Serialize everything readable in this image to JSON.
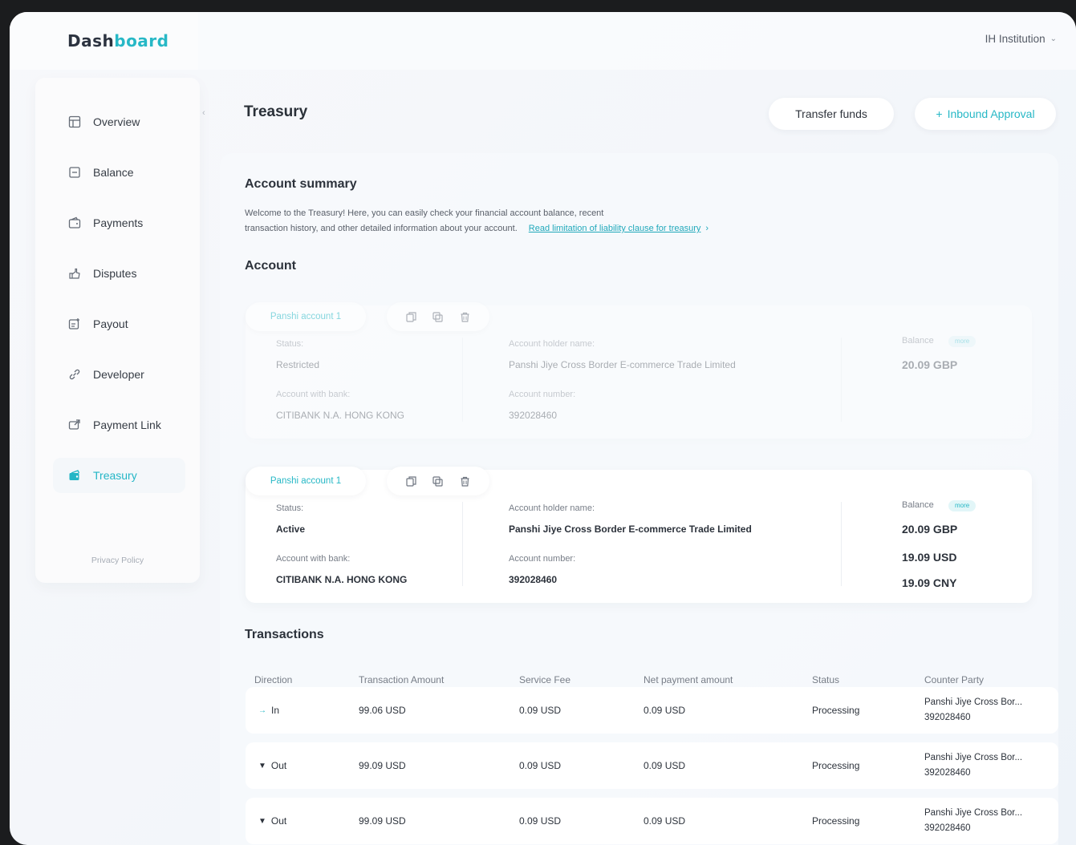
{
  "app": {
    "logo_part1": "Dash",
    "logo_part2": "board",
    "institution": "IH Institution"
  },
  "sidebar": {
    "items": [
      {
        "label": "Overview",
        "icon": "grid-icon"
      },
      {
        "label": "Balance",
        "icon": "balance-icon"
      },
      {
        "label": "Payments",
        "icon": "wallet-icon"
      },
      {
        "label": "Disputes",
        "icon": "hand-icon"
      },
      {
        "label": "Payout",
        "icon": "payout-icon"
      },
      {
        "label": "Developer",
        "icon": "link-icon"
      },
      {
        "label": "Payment Link",
        "icon": "payment-link-icon"
      },
      {
        "label": "Treasury",
        "icon": "treasury-icon",
        "active": true
      }
    ],
    "privacy": "Privacy Policy"
  },
  "header": {
    "title": "Treasury",
    "transfer_label": "Transfer funds",
    "inbound_label": "Inbound Approval",
    "inbound_prefix": "+"
  },
  "summary": {
    "title": "Account summary",
    "text_line1": "Welcome to the Treasury! Here, you can easily check your financial account balance, recent",
    "text_line2": "transaction history, and other detailed information about your account.",
    "link": "Read limitation of liability clause for treasury",
    "link_arrow": "›"
  },
  "account_section": {
    "title": "Account"
  },
  "accounts": [
    {
      "tab": "Panshi account 1",
      "status_label": "Status:",
      "status": "Restricted",
      "bank_label": "Account with bank:",
      "bank": "CITIBANK N.A. HONG KONG",
      "holder_label": "Account holder name:",
      "holder": "Panshi Jiye Cross Border E-commerce Trade Limited",
      "number_label": "Account number:",
      "number": "392028460",
      "balance_label": "Balance",
      "badge": "more",
      "balances": [
        "20.09 GBP"
      ]
    },
    {
      "tab": "Panshi account 1",
      "status_label": "Status:",
      "status": "Active",
      "bank_label": "Account with bank:",
      "bank": "CITIBANK N.A. HONG KONG",
      "holder_label": "Account holder name:",
      "holder": "Panshi Jiye Cross Border E-commerce Trade Limited",
      "number_label": "Account number:",
      "number": "392028460",
      "balance_label": "Balance",
      "badge": "more",
      "balances": [
        "20.09 GBP",
        "19.09 USD",
        "19.09 CNY"
      ]
    }
  ],
  "transactions": {
    "title": "Transactions",
    "columns": [
      "Direction",
      "Transaction Amount",
      "Service Fee",
      "Net payment amount",
      "Status",
      "Counter Party"
    ],
    "rows": [
      {
        "direction": "In",
        "amount": "99.06 USD",
        "fee": "0.09 USD",
        "net": "0.09 USD",
        "status": "Processing",
        "cp_name": "Panshi Jiye Cross Bor...",
        "cp_number": "392028460"
      },
      {
        "direction": "Out",
        "amount": "99.09 USD",
        "fee": "0.09 USD",
        "net": "0.09 USD",
        "status": "Processing",
        "cp_name": "Panshi Jiye Cross Bor...",
        "cp_number": "392028460"
      },
      {
        "direction": "Out",
        "amount": "99.09 USD",
        "fee": "0.09 USD",
        "net": "0.09 USD",
        "status": "Processing",
        "cp_name": "Panshi Jiye Cross Bor...",
        "cp_number": "392028460"
      }
    ]
  }
}
